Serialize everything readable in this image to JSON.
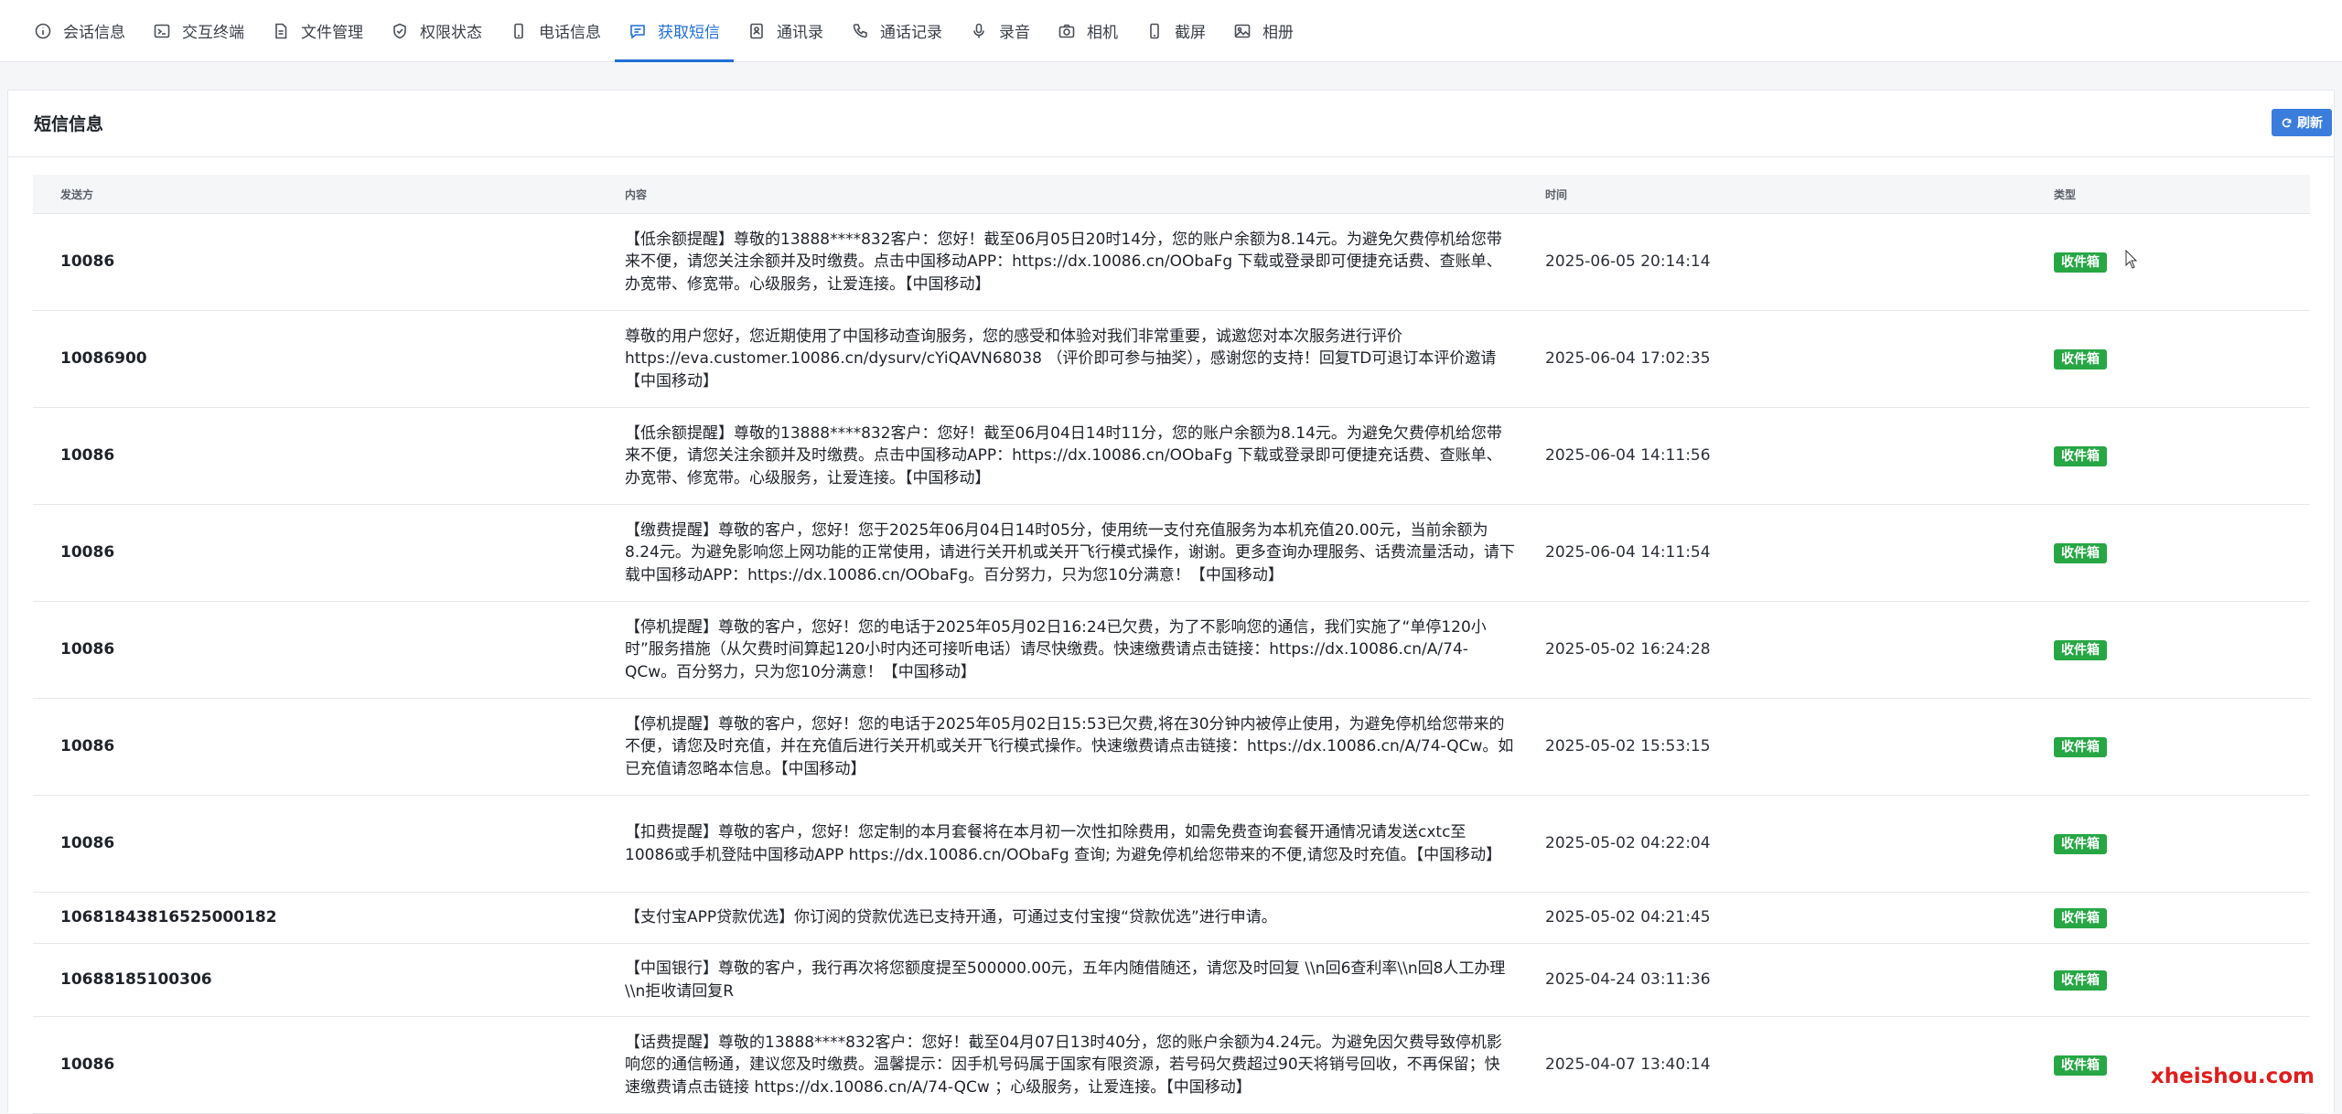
{
  "nav": {
    "tabs": [
      {
        "label": "会话信息",
        "icon": "info-icon"
      },
      {
        "label": "交互终端",
        "icon": "terminal-icon"
      },
      {
        "label": "文件管理",
        "icon": "file-icon"
      },
      {
        "label": "权限状态",
        "icon": "shield-icon"
      },
      {
        "label": "电话信息",
        "icon": "phone-device-icon"
      },
      {
        "label": "获取短信",
        "icon": "message-icon",
        "active": true
      },
      {
        "label": "通讯录",
        "icon": "contacts-icon"
      },
      {
        "label": "通话记录",
        "icon": "phone-call-icon"
      },
      {
        "label": "录音",
        "icon": "microphone-icon"
      },
      {
        "label": "相机",
        "icon": "camera-icon"
      },
      {
        "label": "截屏",
        "icon": "screenshot-icon"
      },
      {
        "label": "相册",
        "icon": "image-icon"
      }
    ]
  },
  "card": {
    "title": "短信信息",
    "refresh_label": "刷新"
  },
  "table": {
    "headers": {
      "sender": "发送方",
      "content": "内容",
      "time": "时间",
      "type": "类型"
    },
    "rows": [
      {
        "sender": "10086",
        "content": "【低余额提醒】尊敬的13888****832客户：您好！截至06月05日20时14分，您的账户余额为8.14元。为避免欠费停机给您带来不便，请您关注余额并及时缴费。点击中国移动APP：https://dx.10086.cn/OObaFg 下载或登录即可便捷充话费、查账单、办宽带、修宽带。心级服务，让爱连接。【中国移动】",
        "time": "2025-06-05 20:14:14",
        "type": "收件箱"
      },
      {
        "sender": "10086900",
        "content": "尊敬的用户您好，您近期使用了中国移动查询服务，您的感受和体验对我们非常重要，诚邀您对本次服务进行评价 https://eva.customer.10086.cn/dysurv/cYiQAVN68038 （评价即可参与抽奖），感谢您的支持！回复TD可退订本评价邀请【中国移动】",
        "time": "2025-06-04 17:02:35",
        "type": "收件箱"
      },
      {
        "sender": "10086",
        "content": "【低余额提醒】尊敬的13888****832客户：您好！截至06月04日14时11分，您的账户余额为8.14元。为避免欠费停机给您带来不便，请您关注余额并及时缴费。点击中国移动APP：https://dx.10086.cn/OObaFg 下载或登录即可便捷充话费、查账单、办宽带、修宽带。心级服务，让爱连接。【中国移动】",
        "time": "2025-06-04 14:11:56",
        "type": "收件箱"
      },
      {
        "sender": "10086",
        "content": "【缴费提醒】尊敬的客户，您好！您于2025年06月04日14时05分，使用统一支付充值服务为本机充值20.00元，当前余额为8.24元。为避免影响您上网功能的正常使用，请进行关开机或关开飞行模式操作，谢谢。更多查询办理服务、话费流量活动，请下载中国移动APP：https://dx.10086.cn/OObaFg。百分努力，只为您10分满意！【中国移动】",
        "time": "2025-06-04 14:11:54",
        "type": "收件箱"
      },
      {
        "sender": "10086",
        "content": "【停机提醒】尊敬的客户，您好！您的电话于2025年05月02日16:24已欠费，为了不影响您的通信，我们实施了“单停120小时”服务措施（从欠费时间算起120小时内还可接听电话）请尽快缴费。快速缴费请点击链接：https://dx.10086.cn/A/74-QCw。百分努力，只为您10分满意！【中国移动】",
        "time": "2025-05-02 16:24:28",
        "type": "收件箱"
      },
      {
        "sender": "10086",
        "content": "【停机提醒】尊敬的客户，您好！您的电话于2025年05月02日15:53已欠费,将在30分钟内被停止使用，为避免停机给您带来的不便，请您及时充值，并在充值后进行关开机或关开飞行模式操作。快速缴费请点击链接：https://dx.10086.cn/A/74-QCw。如已充值请忽略本信息。【中国移动】",
        "time": "2025-05-02 15:53:15",
        "type": "收件箱"
      },
      {
        "sender": "10086",
        "content": "【扣费提醒】尊敬的客户，您好！您定制的本月套餐将在本月初一次性扣除费用，如需免费查询套餐开通情况请发送cxtc至10086或手机登陆中国移动APP https://dx.10086.cn/OObaFg 查询; 为避免停机给您带来的不便,请您及时充值。【中国移动】",
        "time": "2025-05-02 04:22:04",
        "type": "收件箱"
      },
      {
        "sender": "10681843816525000182",
        "content": "【支付宝APP贷款优选】你订阅的贷款优选已支持开通，可通过支付宝搜“贷款优选”进行申请。",
        "time": "2025-05-02 04:21:45",
        "type": "收件箱"
      },
      {
        "sender": "10688185100306",
        "content": "【中国银行】尊敬的客户，我行再次将您额度提至500000.00元，五年内随借随还，请您及时回复 \\\\n回6查利率\\\\n回8人工办理\\\\n拒收请回复R",
        "time": "2025-04-24 03:11:36",
        "type": "收件箱"
      },
      {
        "sender": "10086",
        "content": "【话费提醒】尊敬的13888****832客户：您好！截至04月07日13时40分，您的账户余额为4.24元。为避免因欠费导致停机影响您的通信畅通，建议您及时缴费。温馨提示：因手机号码属于国家有限资源，若号码欠费超过90天将销号回收，不再保留；快速缴费请点击链接 https://dx.10086.cn/A/74-QCw ；心级服务，让爱连接。【中国移动】",
        "time": "2025-04-07 13:40:14",
        "type": "收件箱"
      }
    ]
  },
  "watermark": "xheishou.com"
}
